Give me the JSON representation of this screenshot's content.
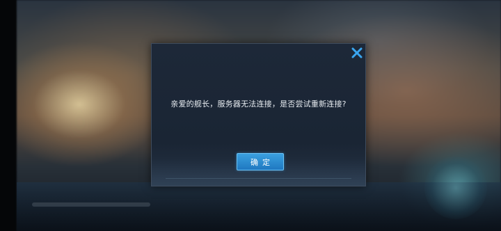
{
  "dialog": {
    "message": "亲爱的舰长，服务器无法连接，是否尝试重新连接?",
    "confirm_label": "确定",
    "close_icon": "close-icon"
  },
  "colors": {
    "accent_button": "#2a8fd6",
    "close_icon": "#3aa6f0",
    "dialog_bg": "#1d2838",
    "message_text": "#e6ebf0"
  }
}
